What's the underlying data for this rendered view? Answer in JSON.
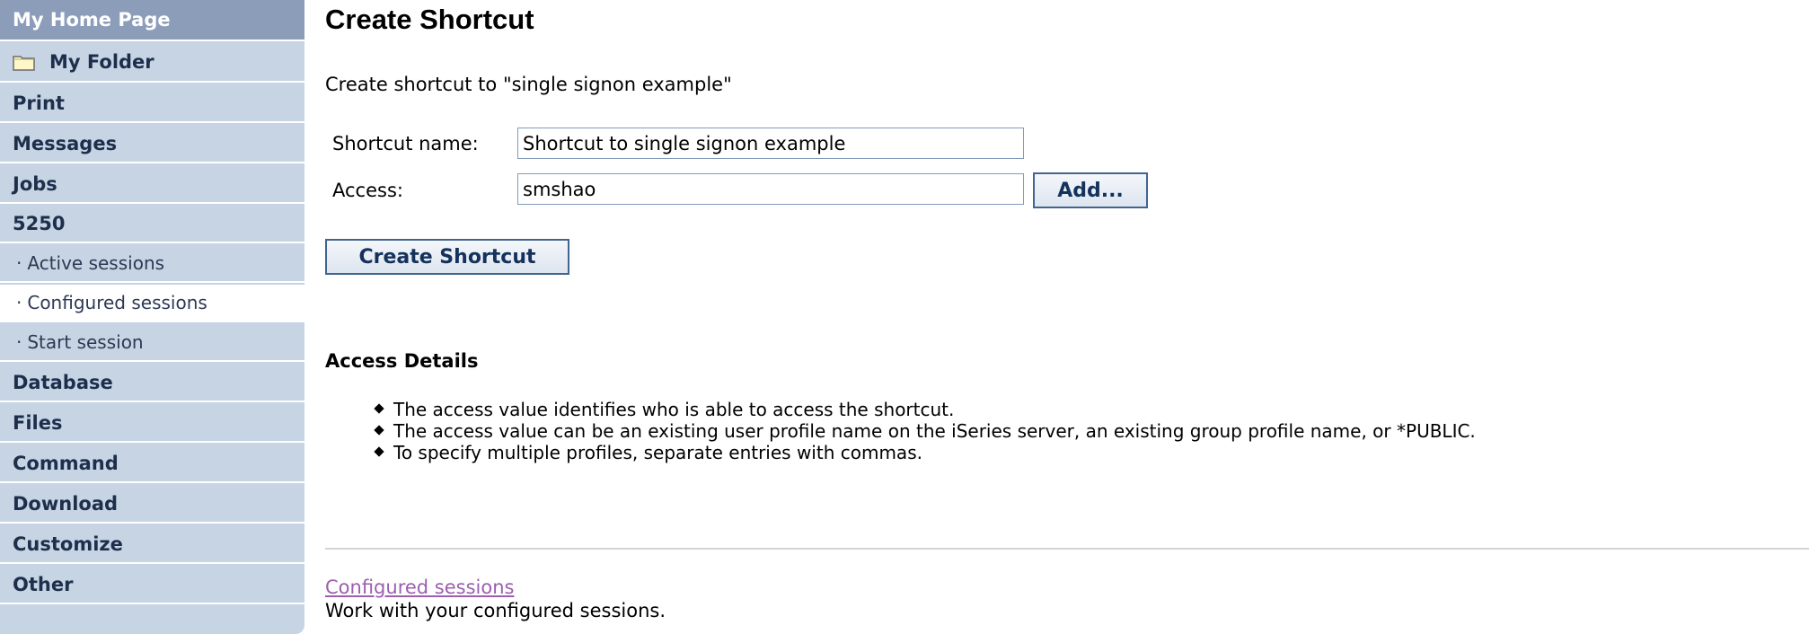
{
  "sidebar": {
    "home": "My Home Page",
    "folder": "My Folder",
    "items": [
      "Print",
      "Messages",
      "Jobs",
      "5250"
    ],
    "sub_items": [
      "Active sessions",
      "Configured sessions",
      "Start session"
    ],
    "items_after": [
      "Database",
      "Files",
      "Command",
      "Download",
      "Customize",
      "Other"
    ],
    "bullet_glyph": "·",
    "folder_icon": "folder-icon",
    "colors": {
      "sidebar_bg": "#c6d4e4",
      "home_bg": "#8c9dba",
      "text": "#1e2f4c"
    }
  },
  "main": {
    "title": "Create Shortcut",
    "intro": "Create shortcut to \"single signon example\"",
    "form": {
      "name_label": "Shortcut name:",
      "name_value": "Shortcut to single signon example",
      "access_label": "Access:",
      "access_value": "smshao",
      "add_button": "Add...",
      "create_button": "Create Shortcut"
    },
    "details": {
      "heading": "Access Details",
      "bullets": [
        "The access value identifies who is able to access the shortcut.",
        "The access value can be an existing user profile name on the iSeries server, an existing group profile name, or *PUBLIC.",
        "To specify multiple profiles, separate entries with commas."
      ]
    },
    "footer": {
      "link": "Configured sessions",
      "description": "Work with your configured sessions."
    },
    "colors": {
      "link": "#9b5fb0",
      "button_border": "#42658f"
    }
  }
}
